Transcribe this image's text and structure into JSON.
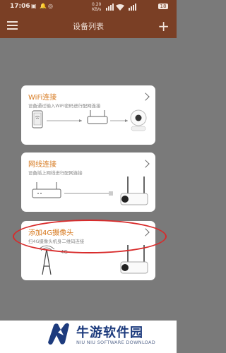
{
  "status_bar": {
    "time": "17:06",
    "mini1": "▣",
    "mini2": "🔔",
    "mini3": "◎",
    "speed_value": "0.20",
    "speed_unit": "KB/s",
    "battery": "18"
  },
  "header": {
    "title": "设备列表",
    "menu_icon": "hamburger-menu-icon",
    "add_icon": "plus-icon",
    "add_label": "+"
  },
  "cards": [
    {
      "title": "WiFi连接",
      "desc": "设备通过输入WiFi密码进行配网连接"
    },
    {
      "title": "网线连接",
      "desc": "设备插上网线进行配网连接"
    },
    {
      "title": "添加4G摄像头",
      "desc": "扫4G摄像头机身二维码连接"
    }
  ],
  "illustration_labels": {
    "badge_4g": "4G"
  },
  "watermark": {
    "title": "牛游软件园",
    "subtitle": "NIU NIU SOFTWARE DOWNLOAD"
  },
  "colors": {
    "header_bg": "#7a3f25",
    "card_title": "#d77a20",
    "highlight_oval": "#d82b2b",
    "brand": "#1d3b7d"
  }
}
